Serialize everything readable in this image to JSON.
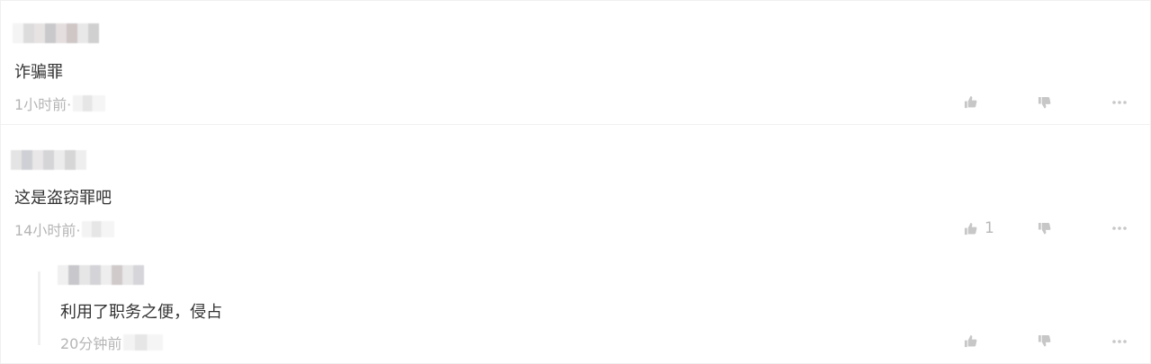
{
  "comments": [
    {
      "content": "诈骗罪",
      "time": "1小时前·",
      "like_count": ""
    },
    {
      "content": "这是盗窃罪吧",
      "time": "14小时前·",
      "like_count": "1"
    }
  ],
  "reply": {
    "content": "利用了职务之便，侵占",
    "time": "20分钟前",
    "like_count": ""
  },
  "colors": {
    "text": "#333333",
    "meta": "#b5b5b5",
    "icon": "#c7c7c7",
    "divider": "#f0f0f0"
  },
  "icons": [
    "thumb-up-icon",
    "thumb-down-icon",
    "more-icon"
  ]
}
